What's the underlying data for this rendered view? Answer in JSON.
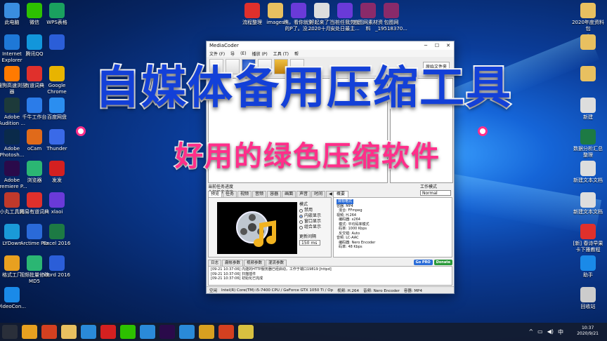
{
  "desktop_icons_left": [
    {
      "label": "此电脑",
      "icon": "computer-icon",
      "color": "#3a8de0"
    },
    {
      "label": "微信",
      "icon": "wechat-icon",
      "color": "#2dc100"
    },
    {
      "label": "WPS表格",
      "icon": "wps-sheet-icon",
      "color": "#1aa15f"
    },
    {
      "label": "Internet Explorer",
      "icon": "ie-icon",
      "color": "#1e78d7"
    },
    {
      "label": "腾讯QQ",
      "icon": "qq-icon",
      "color": "#1296db"
    },
    {
      "label": "",
      "icon": "wps-word-icon",
      "color": "#2b5ed8"
    },
    {
      "label": "搜狗高速浏览器",
      "icon": "sogou-browser-icon",
      "color": "#ff7a00"
    },
    {
      "label": "有道词典",
      "icon": "youdao-icon",
      "color": "#e0302c"
    },
    {
      "label": "Google Chrome",
      "icon": "chrome-icon",
      "color": "#e8b400"
    },
    {
      "label": "Adobe Audition ...",
      "icon": "audition-icon",
      "color": "#1d3a3a"
    },
    {
      "label": "千牛工作台",
      "icon": "qianniu-icon",
      "color": "#2b7ce9"
    },
    {
      "label": "百度网盘",
      "icon": "baidu-pan-icon",
      "color": "#2b8ef0"
    },
    {
      "label": "Adobe Photosh...",
      "icon": "photoshop-icon",
      "color": "#0a2a4a"
    },
    {
      "label": "oCam",
      "icon": "ocam-icon",
      "color": "#e06a1a"
    },
    {
      "label": "Thunder",
      "icon": "thunder-icon",
      "color": "#3a6ae8"
    },
    {
      "label": "Adobe Premiere P...",
      "icon": "premiere-icon",
      "color": "#2a0a4a"
    },
    {
      "label": "浏览器",
      "icon": "browser-icon",
      "color": "#2bb673"
    },
    {
      "label": "发发",
      "icon": "fafa-icon",
      "color": "#d42020"
    },
    {
      "label": "小丸工具箱",
      "icon": "xiaowan-icon",
      "color": "#c0392b"
    },
    {
      "label": "网易有道词典",
      "icon": "netease-youdao-icon",
      "color": "#e0302c"
    },
    {
      "label": "xlaoi",
      "icon": "xlaoi-icon",
      "color": "#6a3ad8"
    },
    {
      "label": "LYDown",
      "icon": "lydown-icon",
      "color": "#1a9ad8"
    },
    {
      "label": "Arctime Pro",
      "icon": "arctime-icon",
      "color": "#2a6ad8"
    },
    {
      "label": "Excel 2016",
      "icon": "excel-icon",
      "color": "#1d7a44"
    },
    {
      "label": "格式工厂",
      "icon": "format-factory-icon",
      "color": "#e8a020"
    },
    {
      "label": "视频批量修改MD5",
      "icon": "md5-icon",
      "color": "#2bb673"
    },
    {
      "label": "Word 2016",
      "icon": "word-icon",
      "color": "#2b5ed8"
    },
    {
      "label": "VideoCon...",
      "icon": "videoconverter-icon",
      "color": "#1a8ae8"
    }
  ],
  "desktop_icons_top": [
    {
      "label": "流程整理",
      "icon": "xmind-icon",
      "color": "#e0302c"
    },
    {
      "label": "images",
      "icon": "folder-icon",
      "color": "#e8c060"
    },
    {
      "label": "瞧，看你就别的P了。没...",
      "icon": "mp4-file-icon",
      "color": "#6a3ad8"
    },
    {
      "label": "好起来了？2020十月...",
      "icon": "document-icon",
      "color": "#dddddd"
    },
    {
      "label": "当桩任我劳代安处日最主...",
      "icon": "mp4-file-icon",
      "color": "#6a3ad8"
    },
    {
      "label": "包图网素材资料",
      "icon": "rar-icon",
      "color": "#8a2a6a"
    },
    {
      "label": "包图网_19518370...",
      "icon": "rar-icon",
      "color": "#8a2a6a"
    }
  ],
  "desktop_icons_right": [
    {
      "label": "2020年度资料包",
      "icon": "folder-icon",
      "color": "#e8c060"
    },
    {
      "label": "",
      "icon": "folder-icon",
      "color": "#e8c060"
    },
    {
      "label": "",
      "icon": "folder-icon",
      "color": "#e8c060"
    },
    {
      "label": "新建",
      "icon": "document-icon",
      "color": "#dddddd"
    },
    {
      "label": "数据分析汇总整理",
      "icon": "excel-file-icon",
      "color": "#1d7a44"
    },
    {
      "label": "新建文本文档",
      "icon": "text-file-icon",
      "color": "#dddddd"
    },
    {
      "label": "新建文本文档",
      "icon": "text-file-icon",
      "color": "#dddddd"
    },
    {
      "label": "[新] 春诗早果卡下雅教程",
      "icon": "pdf-icon",
      "color": "#e0302c"
    },
    {
      "label": "助手",
      "icon": "assistant-icon",
      "color": "#1a8ae8"
    },
    {
      "label": "回收站",
      "icon": "recycle-bin-icon",
      "color": "#cccccc"
    }
  ],
  "window": {
    "title": "MediaCoder",
    "menu": [
      "文件 (F)",
      "导",
      "(E)",
      "播放 (P)",
      "工具 (T)",
      "帮"
    ],
    "toolbar": [
      "",
      "",
      "",
      "",
      "",
      ""
    ],
    "side_button": "原始文件夹",
    "task_label_1": "当前任务进度",
    "task_label_2": "全部任务进度",
    "work_mode_label": "工作模式",
    "work_mode_value": "Normal",
    "tabs_left": [
      "预览",
      "任务",
      "视频",
      "音频",
      "容器",
      "画面",
      "声音",
      "时间"
    ],
    "tab_arrows": "◀ ▶",
    "tabs_right": [
      "概要"
    ],
    "mode_title": "模式",
    "modes": [
      {
        "label": "禁用",
        "on": false
      },
      {
        "label": "内嵌显示",
        "on": true
      },
      {
        "label": "窗口显示",
        "on": false
      },
      {
        "label": "组合显示",
        "on": false
      }
    ],
    "interval_label": "更新间隔",
    "interval_value": "150 ms",
    "overview_header": "目标格式",
    "overview_lines": [
      "容器: MP4",
      "  混合: FFmpeg",
      "视频: H.264",
      "  编码器: x264",
      "  模式: 平均码率模式",
      "  码率: 1000 Kbps",
      "  反交错: Auto",
      "音频: LC-AAC",
      "  编码器: Nero Encoder",
      "  码率: 48 Kbps"
    ],
    "log_tabs": [
      "日志",
      "扁帐参数",
      "视频参数",
      "混流参数"
    ],
    "btn_gopro": "Go PRO",
    "btn_donate": "Donate",
    "log_lines": [
      "[09-21 10:37:06] 内建的HTTP服务器已经启动，工作于端口19819 [httpd]",
      "[09-21 10:37:06] 扫描插件",
      "[09-21 10:37:06] 初始化已完成"
    ],
    "status": [
      "空闲",
      "Intel(R) Core(TM) i5-7400 CPU / GeForce GTX 1050 Ti / Op",
      "视频: H.264",
      "音频: Nero Encoder",
      "容器: MP4"
    ]
  },
  "overlay": {
    "headline": "自媒体备用压缩工具",
    "subline": "好用的绿色压缩软件"
  },
  "taskbar": {
    "items": [
      {
        "icon": "start-icon",
        "color": "#2a2f3a"
      },
      {
        "icon": "taskbar-browser-icon",
        "color": "#e8a020"
      },
      {
        "icon": "taskbar-search-icon",
        "color": "#d44020"
      },
      {
        "icon": "taskbar-explorer-icon",
        "color": "#e8c060"
      },
      {
        "icon": "taskbar-sogou-icon",
        "color": "#2a8ad8"
      },
      {
        "icon": "taskbar-xmind-icon",
        "color": "#d42020"
      },
      {
        "icon": "taskbar-wechat-icon",
        "color": "#2dc100"
      },
      {
        "icon": "taskbar-app-icon",
        "color": "#2a8ad8"
      },
      {
        "icon": "taskbar-premiere-icon",
        "color": "#2a0a4a"
      },
      {
        "icon": "taskbar-feishu-icon",
        "color": "#2a8ad8"
      },
      {
        "icon": "taskbar-paint-icon",
        "color": "#d8a020"
      },
      {
        "icon": "taskbar-ppt-icon",
        "color": "#d44020"
      },
      {
        "icon": "taskbar-mediacoder-icon",
        "color": "#d8c040"
      }
    ],
    "time": "10:37",
    "date": "2020/9/21"
  }
}
